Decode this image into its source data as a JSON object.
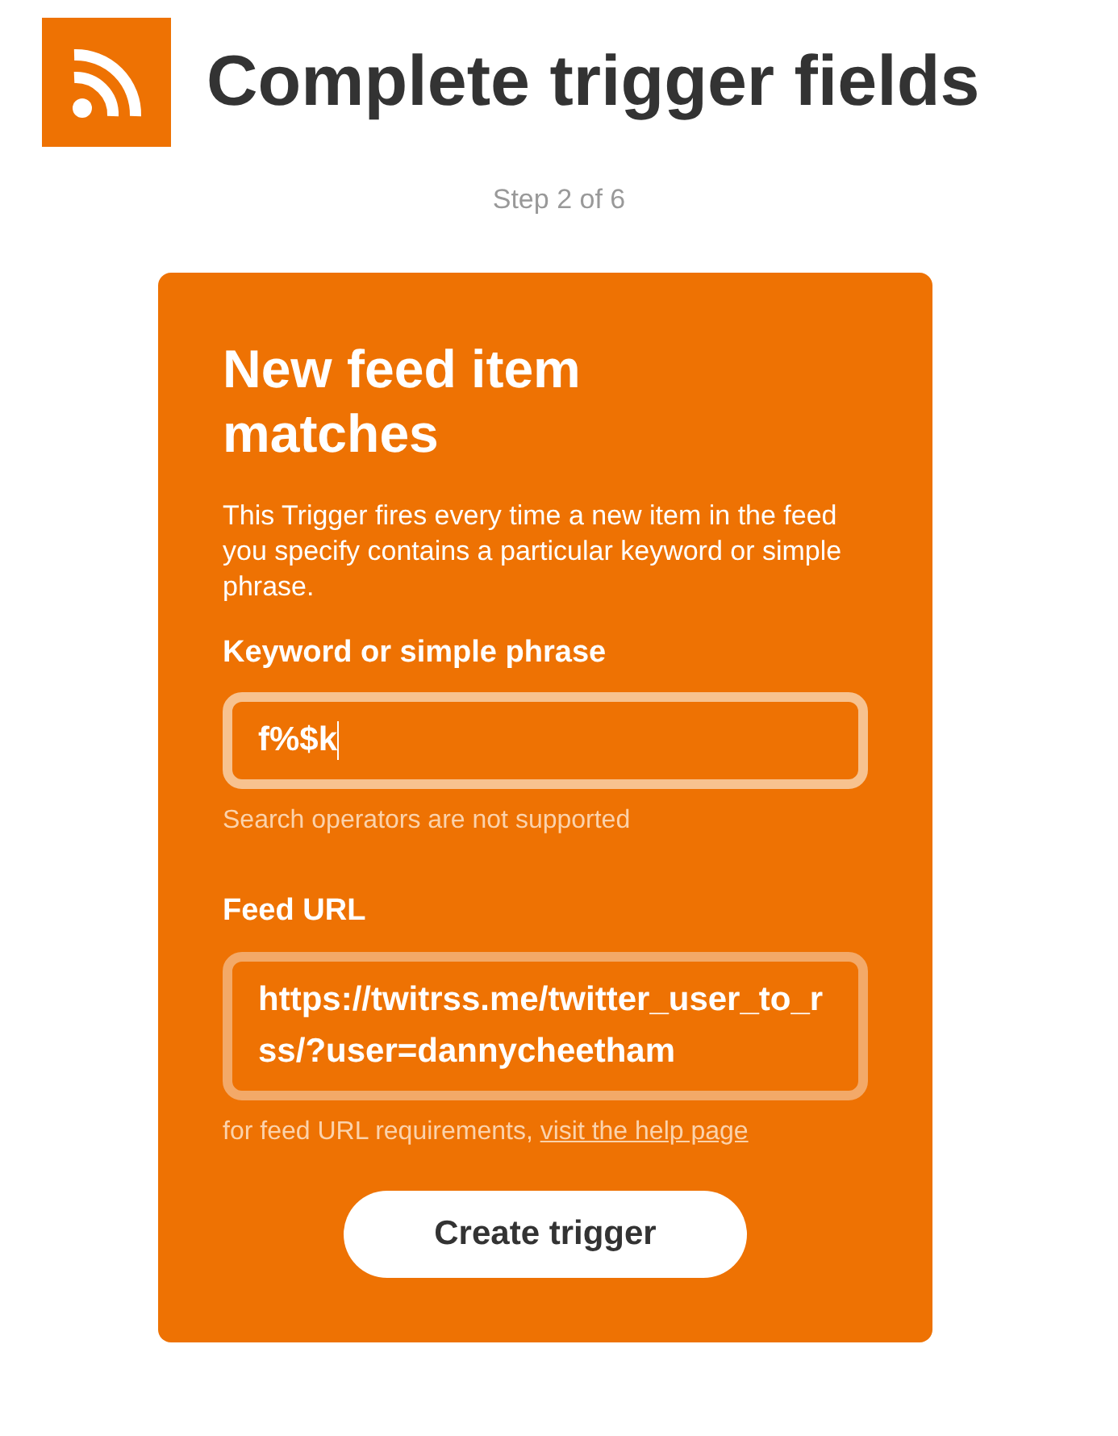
{
  "header": {
    "title": "Complete trigger fields",
    "step": "Step 2 of 6"
  },
  "card": {
    "title": "New feed item matches",
    "description": "This Trigger fires every time a new item in the feed you specify contains a particular keyword or simple phrase.",
    "fields": [
      {
        "label": "Keyword or simple phrase",
        "value": "f%$k",
        "focused": true,
        "help": "Search operators are not supported"
      },
      {
        "label": "Feed URL",
        "value": "https://twitrss.me/twitter_user_to_rss/?user=dannycheetham",
        "focused": false,
        "help": "for feed URL requirements, ",
        "help_link": "visit the help page"
      }
    ],
    "button": "Create trigger"
  }
}
